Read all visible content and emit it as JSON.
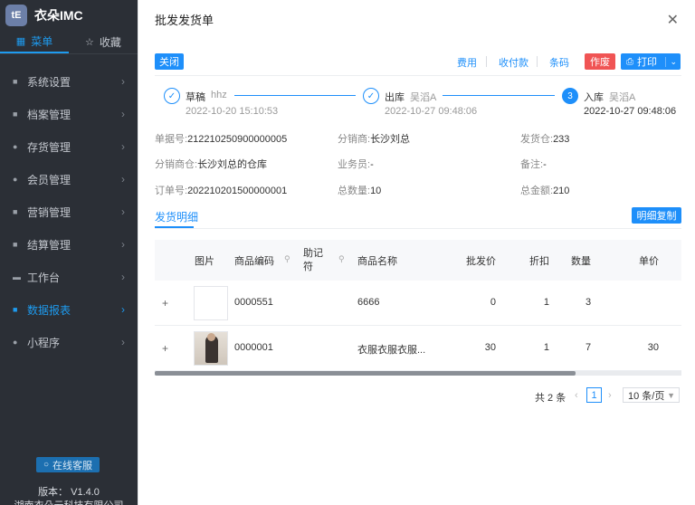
{
  "app": {
    "logo_text": "tE",
    "name": "衣朵IMC"
  },
  "sidebar": {
    "tabs": [
      {
        "icon": "grid-icon",
        "label": "菜单"
      },
      {
        "icon": "star-icon",
        "label": "收藏"
      }
    ],
    "items": [
      {
        "label": "系统设置"
      },
      {
        "label": "档案管理"
      },
      {
        "label": "存货管理"
      },
      {
        "label": "会员管理"
      },
      {
        "label": "营销管理"
      },
      {
        "label": "结算管理"
      },
      {
        "label": "工作台"
      },
      {
        "label": "数据报表",
        "active": true
      },
      {
        "label": "小程序"
      }
    ],
    "service_button": "在线客服",
    "version": "版本： V1.4.0",
    "company": "湖南衣朵云科技有限公司"
  },
  "drawer": {
    "title": "批发发货单",
    "close_button": "关闭",
    "actions": {
      "fee": "费用",
      "payment": "收付款",
      "barcode": "条码",
      "void": "作废",
      "print": "打印"
    },
    "steps": [
      {
        "name": "草稿",
        "user": "hhz",
        "time": "2022-10-20 15:10:53",
        "status": "done"
      },
      {
        "name": "出库",
        "user": "吴滔A",
        "time": "2022-10-27 09:48:06",
        "status": "done"
      },
      {
        "number": "3",
        "name": "入库",
        "user": "吴滔A",
        "time": "2022-10-27 09:48:06",
        "status": "current"
      }
    ],
    "info": {
      "doc_no_label": "单据号:",
      "doc_no": "212210250900000005",
      "distributor_label": "分销商:",
      "distributor": "长沙刘总",
      "ship_wh_label": "发货仓:",
      "ship_wh": "233",
      "dist_wh_label": "分销商仓:",
      "dist_wh": "长沙刘总的仓库",
      "salesman_label": "业务员:",
      "salesman": "-",
      "remark_label": "备注:",
      "remark": "-",
      "order_no_label": "订单号:",
      "order_no": "202210201500000001",
      "total_qty_label": "总数量:",
      "total_qty": "10",
      "total_amt_label": "总金额:",
      "total_amt": "210"
    },
    "detail_tab": "发货明细",
    "copy_button": "明细复制",
    "table": {
      "headers": {
        "image": "图片",
        "code": "商品编码",
        "mnemonic": "助记符",
        "name": "商品名称",
        "price": "批发价",
        "discount": "折扣",
        "qty": "数量",
        "unit_price": "单价"
      },
      "rows": [
        {
          "code": "0000551",
          "name": "6666",
          "price": "0",
          "discount": "1",
          "qty": "3",
          "unit_price": ""
        },
        {
          "code": "0000001",
          "name": "衣服衣服衣服...",
          "price": "30",
          "discount": "1",
          "qty": "7",
          "unit_price": "30"
        }
      ]
    },
    "pagination": {
      "total": "共 2 条",
      "current": "1",
      "page_size": "10 条/页"
    }
  }
}
